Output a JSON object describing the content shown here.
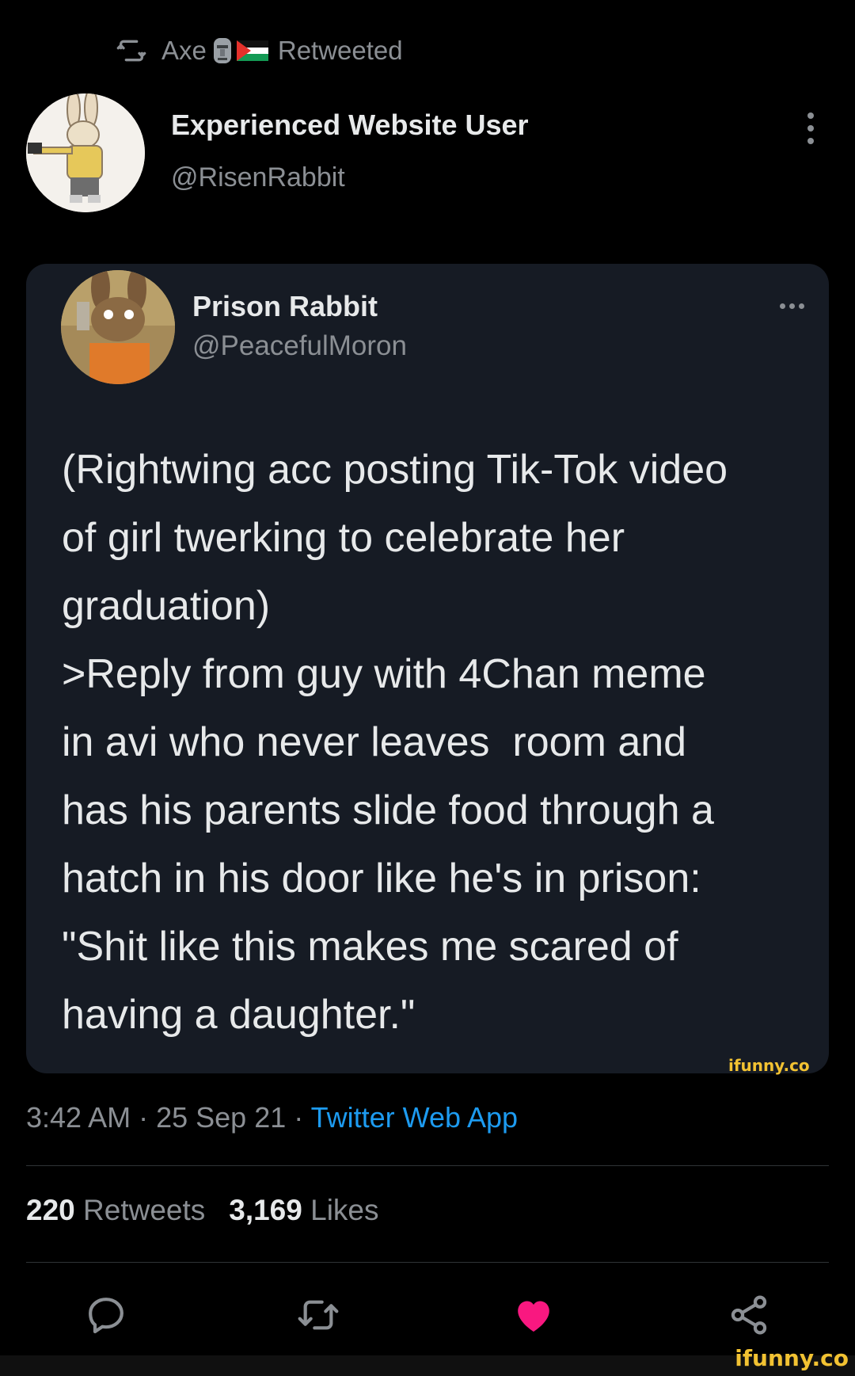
{
  "retweet_bar": {
    "user": "Axe",
    "label": "Retweeted",
    "icon": "retweet-icon"
  },
  "author": {
    "name": "Experienced Website User",
    "handle": "@RisenRabbit"
  },
  "quoted": {
    "name": "Prison Rabbit",
    "handle": "@PeacefulMoron",
    "paragraph1": "(Rightwing acc posting Tik-Tok video\nof girl twerking to celebrate her\ngraduation)",
    "paragraph2": ">Reply from guy with 4Chan meme\nin avi who never leaves  room and\nhas his parents slide food through a\nhatch in his door like he's in prison:\n\"Shit like this makes me scared of\nhaving a daughter.\""
  },
  "meta": {
    "time": "3:42 AM",
    "sep1": " · ",
    "date": "25 Sep 21",
    "sep2": " · ",
    "source": "Twitter Web App"
  },
  "stats": {
    "retweets_count": "220",
    "retweets_label": "Retweets",
    "likes_count": "3,169",
    "likes_label": "Likes"
  },
  "watermark": "ifunny.co",
  "colors": {
    "background": "#000000",
    "card": "#161b24",
    "link": "#1d9bf0",
    "like": "#f91880",
    "muted": "#8b8f94",
    "watermark": "#f2c232"
  },
  "actions": [
    "reply-icon",
    "retweet-icon",
    "like-icon",
    "share-icon"
  ]
}
